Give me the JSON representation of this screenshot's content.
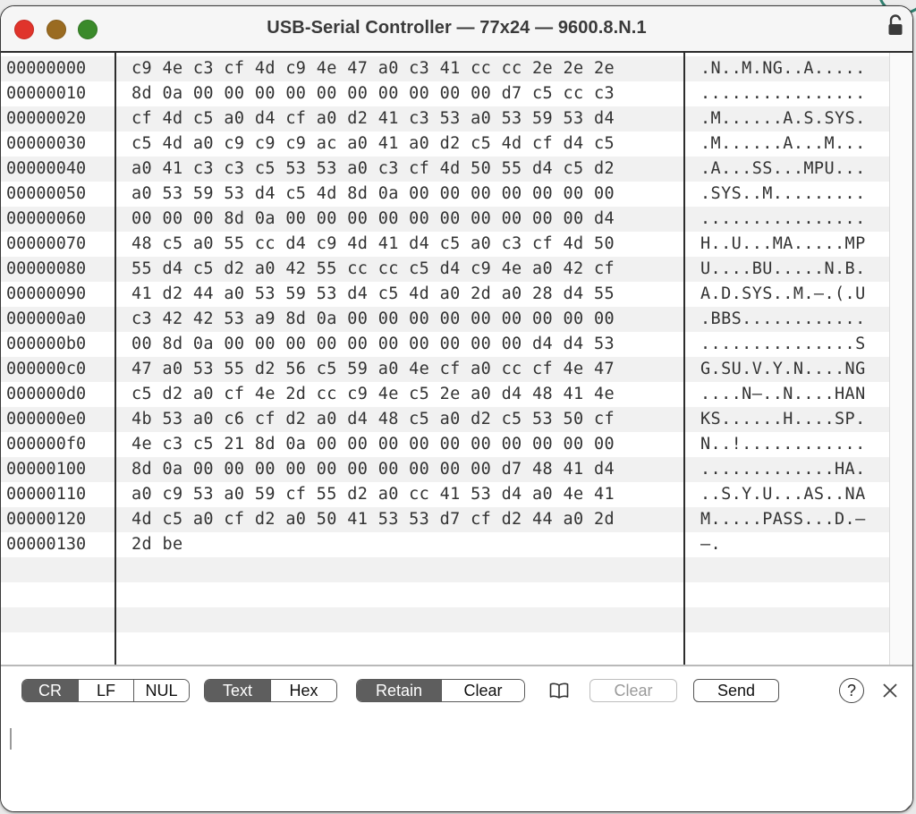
{
  "window": {
    "title": "USB-Serial Controller — 77x24 — 9600.8.N.1",
    "colors": {
      "close": "#e0342b",
      "minimize": "#9a6b21",
      "zoom": "#3a8a2a"
    }
  },
  "hex_dump": {
    "rows": [
      {
        "addr": "00000000",
        "hex": "c9 4e c3 cf 4d c9 4e 47 a0 c3 41 cc cc 2e 2e 2e",
        "ascii": ".N..M.NG..A....."
      },
      {
        "addr": "00000010",
        "hex": "8d 0a 00 00 00 00 00 00 00 00 00 00 d7 c5 cc c3",
        "ascii": "................"
      },
      {
        "addr": "00000020",
        "hex": "cf 4d c5 a0 d4 cf a0 d2 41 c3 53 a0 53 59 53 d4",
        "ascii": ".M......A.S.SYS."
      },
      {
        "addr": "00000030",
        "hex": "c5 4d a0 c9 c9 c9 ac a0 41 a0 d2 c5 4d cf d4 c5",
        "ascii": ".M......A...M..."
      },
      {
        "addr": "00000040",
        "hex": "a0 41 c3 c3 c5 53 53 a0 c3 cf 4d 50 55 d4 c5 d2",
        "ascii": ".A...SS...MPU..."
      },
      {
        "addr": "00000050",
        "hex": "a0 53 59 53 d4 c5 4d 8d 0a 00 00 00 00 00 00 00",
        "ascii": ".SYS..M........."
      },
      {
        "addr": "00000060",
        "hex": "00 00 00 8d 0a 00 00 00 00 00 00 00 00 00 00 d4",
        "ascii": "................"
      },
      {
        "addr": "00000070",
        "hex": "48 c5 a0 55 cc d4 c9 4d 41 d4 c5 a0 c3 cf 4d 50",
        "ascii": "H..U...MA.....MP"
      },
      {
        "addr": "00000080",
        "hex": "55 d4 c5 d2 a0 42 55 cc cc c5 d4 c9 4e a0 42 cf",
        "ascii": "U....BU.....N.B."
      },
      {
        "addr": "00000090",
        "hex": "41 d2 44 a0 53 59 53 d4 c5 4d a0 2d a0 28 d4 55",
        "ascii": "A.D.SYS..M.–.(.U"
      },
      {
        "addr": "000000a0",
        "hex": "c3 42 42 53 a9 8d 0a 00 00 00 00 00 00 00 00 00",
        "ascii": ".BBS............"
      },
      {
        "addr": "000000b0",
        "hex": "00 8d 0a 00 00 00 00 00 00 00 00 00 00 d4 d4 53",
        "ascii": "...............S"
      },
      {
        "addr": "000000c0",
        "hex": "47 a0 53 55 d2 56 c5 59 a0 4e cf a0 cc cf 4e 47",
        "ascii": "G.SU.V.Y.N....NG"
      },
      {
        "addr": "000000d0",
        "hex": "c5 d2 a0 cf 4e 2d cc c9 4e c5 2e a0 d4 48 41 4e",
        "ascii": "....N–..N....HAN"
      },
      {
        "addr": "000000e0",
        "hex": "4b 53 a0 c6 cf d2 a0 d4 48 c5 a0 d2 c5 53 50 cf",
        "ascii": "KS......H....SP."
      },
      {
        "addr": "000000f0",
        "hex": "4e c3 c5 21 8d 0a 00 00 00 00 00 00 00 00 00 00",
        "ascii": "N..!............"
      },
      {
        "addr": "00000100",
        "hex": "8d 0a 00 00 00 00 00 00 00 00 00 00 d7 48 41 d4",
        "ascii": ".............HA."
      },
      {
        "addr": "00000110",
        "hex": "a0 c9 53 a0 59 cf 55 d2 a0 cc 41 53 d4 a0 4e 41",
        "ascii": "..S.Y.U...AS..NA"
      },
      {
        "addr": "00000120",
        "hex": "4d c5 a0 cf d2 a0 50 41 53 53 d7 cf d2 44 a0 2d",
        "ascii": "M.....PASS...D.–"
      },
      {
        "addr": "00000130",
        "hex": "2d be",
        "ascii": "–."
      },
      {
        "addr": "",
        "hex": "",
        "ascii": ""
      },
      {
        "addr": "",
        "hex": "",
        "ascii": ""
      },
      {
        "addr": "",
        "hex": "",
        "ascii": ""
      },
      {
        "addr": "",
        "hex": "",
        "ascii": ""
      }
    ]
  },
  "toolbar": {
    "line_ending": {
      "options": [
        "CR",
        "LF",
        "NUL"
      ],
      "selected": "CR"
    },
    "display_mode": {
      "options": [
        "Text",
        "Hex"
      ],
      "selected": "Text"
    },
    "buffer_mode": {
      "options": [
        "Retain",
        "Clear"
      ],
      "selected": "Retain"
    },
    "icons": {
      "book": "book-icon",
      "help": "help-icon",
      "close": "close-icon"
    },
    "clear_label": "Clear",
    "clear_enabled": false,
    "send_label": "Send",
    "help_label": "?"
  },
  "input": {
    "value": "",
    "placeholder": ""
  }
}
